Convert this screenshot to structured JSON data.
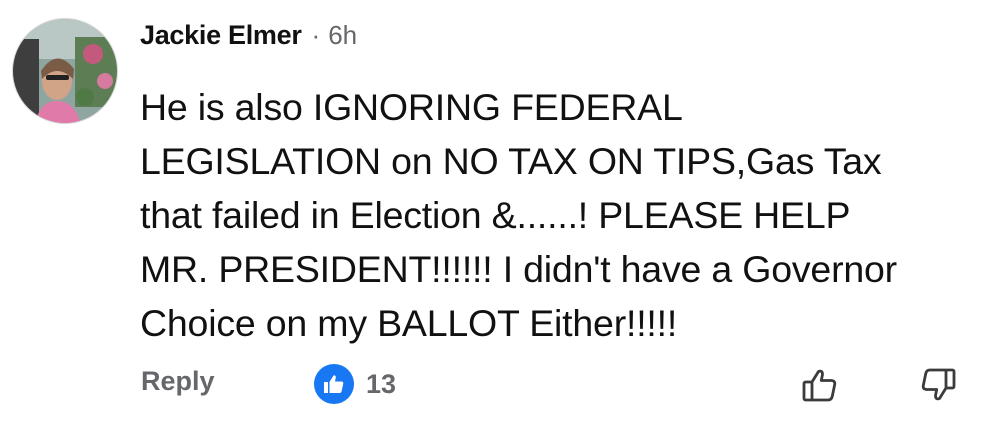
{
  "comment": {
    "author": "Jackie Elmer",
    "separator": "·",
    "time": "6h",
    "lines": [
      "He is also IGNORING FEDERAL",
      "LEGISLATION on NO TAX ON TIPS,Gas Tax",
      "that failed in Election &......! PLEASE HELP",
      "MR. PRESIDENT!!!!!! I didn't have a Governor",
      "Choice on my BALLOT Either!!!!!"
    ]
  },
  "actions": {
    "reply_label": "Reply",
    "reaction_count": "13",
    "reaction_icon": "like-icon",
    "upvote_icon": "thumbs-up-outline-icon",
    "downvote_icon": "thumbs-down-outline-icon"
  },
  "colors": {
    "accent": "#1877f2",
    "muted_text": "#65676b",
    "text": "#111111"
  }
}
